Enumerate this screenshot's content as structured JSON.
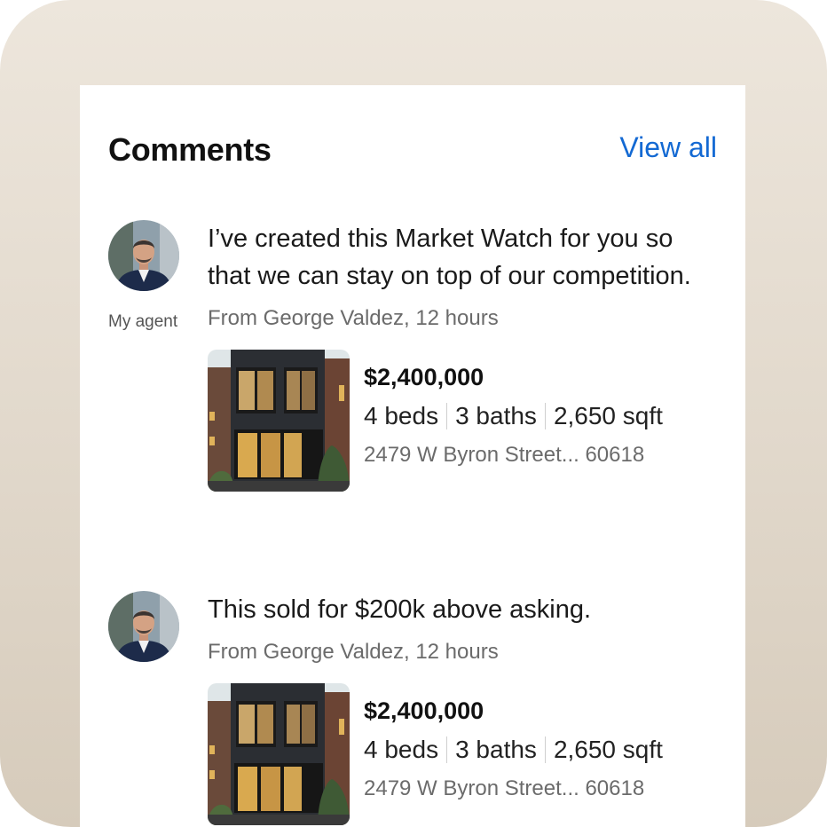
{
  "header": {
    "title": "Comments",
    "view_all_label": "View all"
  },
  "comments": [
    {
      "agent_label": "My agent",
      "message": "I’ve created this Market Watch for you so that we can stay on top of our competition.",
      "from": "From George Valdez, 12 hours",
      "listing": {
        "price": "$2,400,000",
        "beds": "4 beds",
        "baths": "3 baths",
        "sqft": "2,650 sqft",
        "address": "2479 W Byron Street... 60618"
      }
    },
    {
      "message": "This sold for $200k above asking.",
      "from": "From George Valdez, 12 hours",
      "listing": {
        "price": "$2,400,000",
        "beds": "4 beds",
        "baths": "3 baths",
        "sqft": "2,650 sqft",
        "address": "2479 W Byron Street... 60618"
      }
    }
  ],
  "colors": {
    "accent": "#1369d3",
    "text": "#111111",
    "muted": "#6b6b6b",
    "backdrop": "#e4dbcf"
  }
}
